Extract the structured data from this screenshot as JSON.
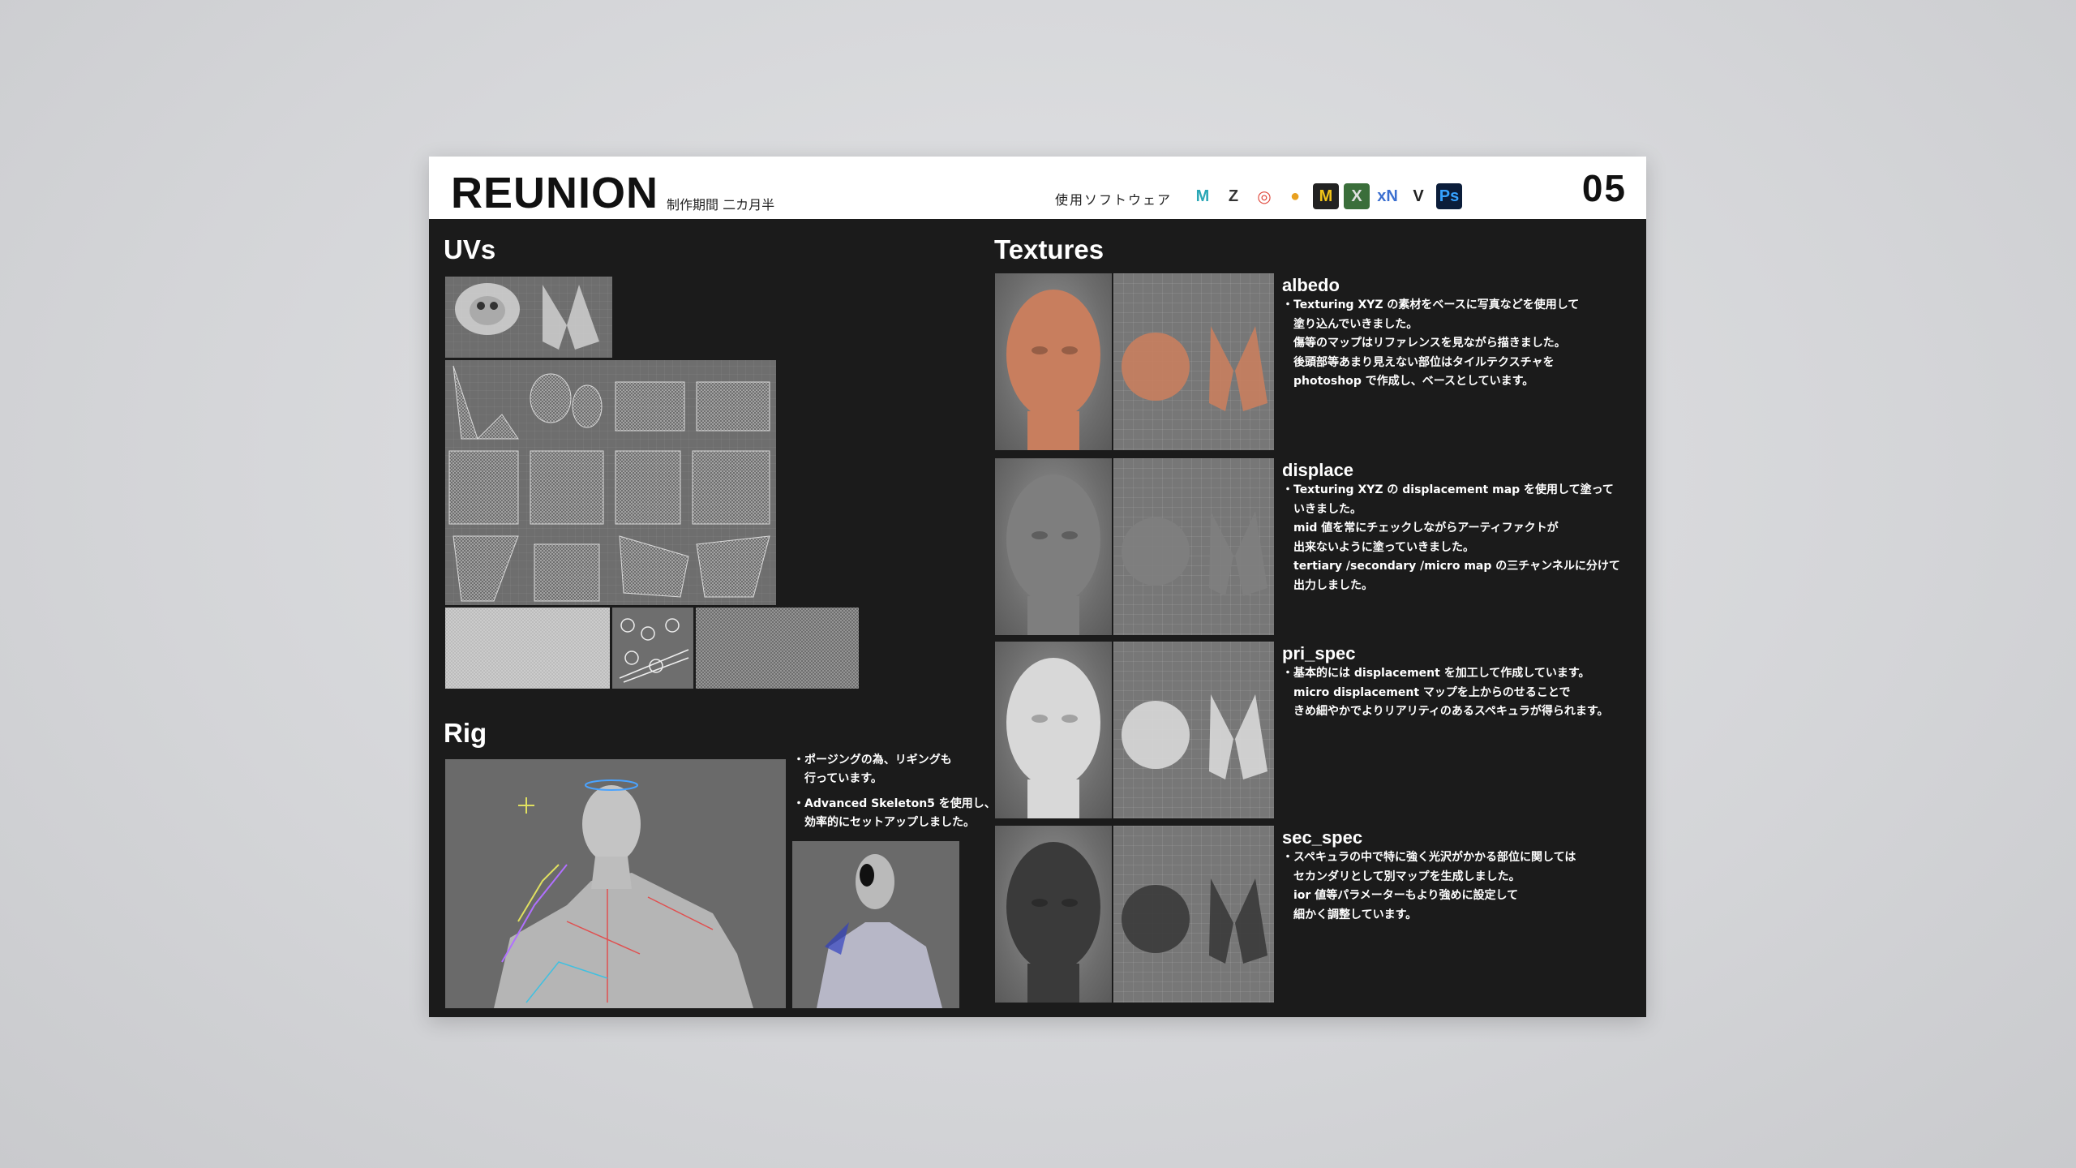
{
  "header": {
    "title": "REUNION",
    "period": "制作期間 二カ月半",
    "software_label": "使用ソフトウェア",
    "page_number": "05",
    "software_icons": [
      {
        "name": "maya-icon",
        "glyph": "M",
        "bg": "#ffffff",
        "fg": "#2aa7b6"
      },
      {
        "name": "zbrush-icon",
        "glyph": "Z",
        "bg": "#ffffff",
        "fg": "#333333"
      },
      {
        "name": "houdini-icon",
        "glyph": "◎",
        "bg": "#ffffff",
        "fg": "#e0483c"
      },
      {
        "name": "substance-icon",
        "glyph": "●",
        "bg": "#ffffff",
        "fg": "#e8a020"
      },
      {
        "name": "marvelous-icon",
        "glyph": "M",
        "bg": "#222222",
        "fg": "#f2c418"
      },
      {
        "name": "xyz-icon",
        "glyph": "X",
        "bg": "#3a6e3a",
        "fg": "#e0e0e0"
      },
      {
        "name": "xnormal-icon",
        "glyph": "xN",
        "bg": "#ffffff",
        "fg": "#3b6fd0"
      },
      {
        "name": "vray-icon",
        "glyph": "V",
        "bg": "#ffffff",
        "fg": "#222222"
      },
      {
        "name": "photoshop-icon",
        "glyph": "Ps",
        "bg": "#0b1d3a",
        "fg": "#36a2ff"
      }
    ]
  },
  "uvs": {
    "title": "UVs"
  },
  "rig": {
    "title": "Rig",
    "notes": [
      "・ポージングの為、リギングも\n　行っています。",
      "・Advanced Skeleton5 を使用し、\n　効率的にセットアップしました。"
    ]
  },
  "textures": {
    "title": "Textures",
    "items": [
      {
        "name": "albedo",
        "body": "・Texturing XYZ の素材をベースに写真などを使用して\n　塗り込んでいきました。\n　傷等のマップはリファレンスを見ながら描きました。\n　後頭部等あまり見えない部位はタイルテクスチャを\n　photoshop で作成し、ベースとしています。",
        "skin": "#c87e5e"
      },
      {
        "name": "displace",
        "body": "・Texturing XYZ の displacement map を使用して塗って\n　いきました。\n　mid 値を常にチェックしながらアーティファクトが\n　出来ないように塗っていきました。\n　tertiary /secondary /micro map の三チャンネルに分けて\n　出力しました。",
        "skin": "#7e7e7e"
      },
      {
        "name": "pri_spec",
        "body": "・基本的には displacement を加工して作成しています。\n　micro displacement マップを上からのせることで\n　きめ細やかでよりリアリティのあるスペキュラが得られます。",
        "skin": "#d8d8d8"
      },
      {
        "name": "sec_spec",
        "body": "・スペキュラの中で特に強く光沢がかかる部位に関しては\n　セカンダリとして別マップを生成しました。\n　ior 値等パラメーターもより強めに設定して\n　細かく調整しています。",
        "skin": "#3a3a3a"
      }
    ]
  }
}
